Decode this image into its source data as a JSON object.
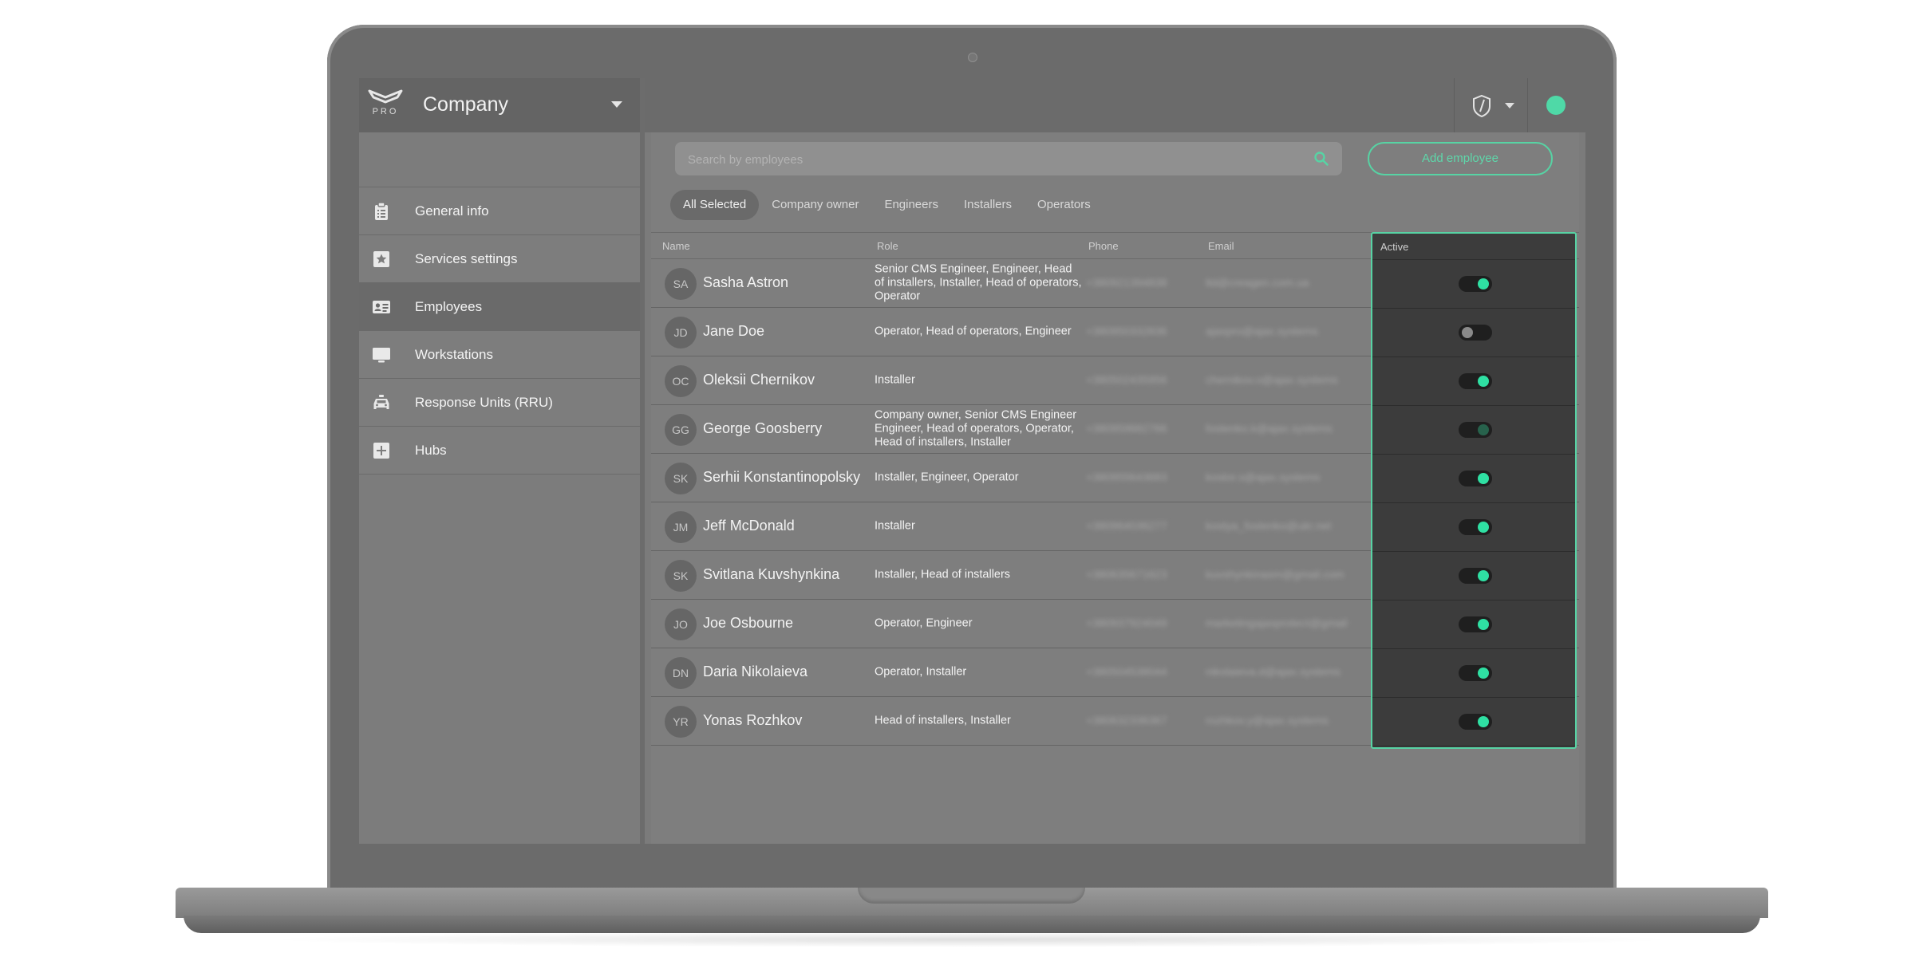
{
  "app": {
    "brand_sub": "PRO",
    "company": "Company"
  },
  "sidebar": {
    "items": [
      {
        "label": "General info",
        "icon": "clipboard-icon"
      },
      {
        "label": "Services settings",
        "icon": "star-icon"
      },
      {
        "label": "Employees",
        "icon": "id-card-icon",
        "active": true
      },
      {
        "label": "Workstations",
        "icon": "monitor-icon"
      },
      {
        "label": "Response Units (RRU)",
        "icon": "car-icon"
      },
      {
        "label": "Hubs",
        "icon": "plus-box-icon"
      }
    ]
  },
  "search": {
    "placeholder": "Search by employees",
    "value": ""
  },
  "actions": {
    "add_employee": "Add employee"
  },
  "filters": [
    "All Selected",
    "Company owner",
    "Engineers",
    "Installers",
    "Operators"
  ],
  "table": {
    "columns": {
      "name": "Name",
      "role": "Role",
      "phone": "Phone",
      "email": "Email",
      "active": "Active"
    },
    "rows": [
      {
        "initials": "SA",
        "name": "Sasha Astron",
        "role": "Senior CMS Engineer, Engineer, Head of installers, Installer, Head of operators, Operator",
        "phone": "+380921394838",
        "email": "ltd@creagen.com.ua",
        "active": "on"
      },
      {
        "initials": "JD",
        "name": "Jane Doe",
        "role": "Operator, Head of operators, Engineer",
        "phone": "+380950332836",
        "email": "ajaxpro@ajax.systems",
        "active": "off"
      },
      {
        "initials": "OC",
        "name": "Oleksii Chernikov",
        "role": "Installer",
        "phone": "+380502435956",
        "email": "chernikov.o@ajax.systems",
        "active": "on"
      },
      {
        "initials": "GG",
        "name": "George Goosberry",
        "role": "Company owner, Senior CMS Engineer Engineer, Head of operators, Operator, Head of installers, Installer",
        "phone": "+380959682766",
        "email": "fostenko.k@ajax.systems",
        "active": "dim"
      },
      {
        "initials": "SK",
        "name": "Serhii Konstantinopolsky",
        "role": "Installer, Engineer, Operator",
        "phone": "+380955643683",
        "email": "kostor.s@ajax.systems",
        "active": "on"
      },
      {
        "initials": "JM",
        "name": "Jeff McDonald",
        "role": "Installer",
        "phone": "+380964036277",
        "email": "kostya_fostenko@ukr.net",
        "active": "on"
      },
      {
        "initials": "SK",
        "name": "Svitlana Kuvshynkina",
        "role": "Installer, Head of installers",
        "phone": "+380635671623",
        "email": "kuvshynkinasm@gmail.com",
        "active": "on"
      },
      {
        "initials": "JO",
        "name": "Joe Osbourne",
        "role": "Operator, Engineer",
        "phone": "+380937924049",
        "email": "marketingajaxprotect@gmail",
        "active": "on"
      },
      {
        "initials": "DN",
        "name": "Daria Nikolaieva",
        "role": "Operator, Installer",
        "phone": "+380504538044",
        "email": "nikolaieva.d@ajax.systems",
        "active": "on"
      },
      {
        "initials": "YR",
        "name": "Yonas Rozhkov",
        "role": "Head of installers, Installer",
        "phone": "+380632336367",
        "email": "rozhkov.y@ajax.systems",
        "active": "on"
      }
    ]
  },
  "colors": {
    "accent": "#57d3a4",
    "toggle_on": "#2fe0a3",
    "status": "#4fd9a7"
  }
}
